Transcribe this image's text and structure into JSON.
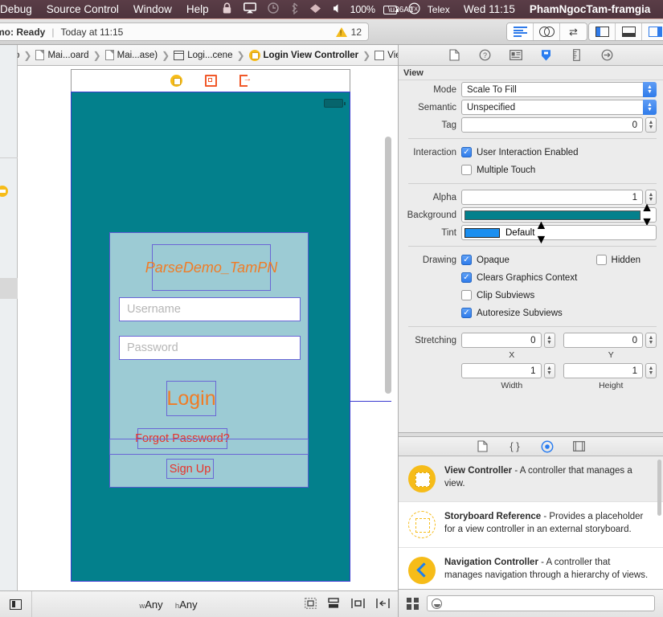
{
  "menubar": {
    "items": [
      "Debug",
      "Source Control",
      "Window",
      "Help"
    ],
    "icons": [
      "lock-icon",
      "airplay-icon",
      "time-machine-icon",
      "bluetooth-icon",
      "wifi-icon",
      "volume-icon"
    ],
    "battery_percent": "100%",
    "input_source": "Telex",
    "clock": "Wed 11:15",
    "user": "PhamNgocTam-framgia",
    "right_icons": [
      "search-icon",
      "control-center-icon"
    ]
  },
  "toolbar": {
    "status_scheme": "mo: Ready",
    "status_separator": "|",
    "status_time": "Today at 11:15",
    "warning_count": "12",
    "editor_buttons": [
      "standard-editor",
      "assistant-editor",
      "version-editor"
    ],
    "panel_buttons": [
      "navigator-toggle",
      "debug-toggle",
      "utilities-toggle"
    ]
  },
  "jumpbar": {
    "crumbs": [
      {
        "label": "emo",
        "icon": "project-icon"
      },
      {
        "label": "Mai...oard",
        "icon": "document-icon"
      },
      {
        "label": "Mai...ase)",
        "icon": "document-icon"
      },
      {
        "label": "Logi...cene",
        "icon": "storyboard-scene-icon"
      },
      {
        "label": "Login View Controller",
        "icon": "view-controller-icon"
      },
      {
        "label": "View",
        "icon": "view-icon"
      }
    ],
    "prev_label": "‹",
    "next_label": "›",
    "issue_icon": "warning-triangle-icon"
  },
  "scene": {
    "dock_items": [
      "view-controller-icon",
      "first-responder-icon",
      "exit-icon"
    ],
    "device_background": "#03808C",
    "panel_background": "#9CCBD4",
    "title": "ParseDemo_TamPN",
    "title_color": "#F07C26",
    "username_placeholder": "Username",
    "password_placeholder": "Password",
    "login_label": "Login",
    "login_color": "#F07C26",
    "forgot_label": "Forgot Password?",
    "signup_label": "Sign Up",
    "link_color": "#E8322A"
  },
  "bottombar": {
    "panel_icon": "view-as-icon",
    "width_prefix": "w",
    "width_value": "Any",
    "height_prefix": "h",
    "height_value": "Any",
    "autolayout_buttons": [
      "update-frames-icon",
      "embed-in-icon",
      "align-icon",
      "pin-icon"
    ]
  },
  "inspector": {
    "tabs": [
      "file-inspector",
      "quick-help-inspector",
      "identity-inspector",
      "attributes-inspector",
      "size-inspector",
      "connections-inspector"
    ],
    "selected_tab": "attributes-inspector",
    "section_title": "View",
    "mode_label": "Mode",
    "mode_value": "Scale To Fill",
    "semantic_label": "Semantic",
    "semantic_value": "Unspecified",
    "tag_label": "Tag",
    "tag_value": "0",
    "interaction_label": "Interaction",
    "user_interaction_label": "User Interaction Enabled",
    "user_interaction_checked": true,
    "multiple_touch_label": "Multiple Touch",
    "multiple_touch_checked": false,
    "alpha_label": "Alpha",
    "alpha_value": "1",
    "background_label": "Background",
    "background_color": "#03808C",
    "tint_label": "Tint",
    "tint_value": "Default",
    "tint_color": "#1b8ff0",
    "drawing_label": "Drawing",
    "opaque_label": "Opaque",
    "opaque_checked": true,
    "hidden_label": "Hidden",
    "hidden_checked": false,
    "clears_label": "Clears Graphics Context",
    "clears_checked": true,
    "clip_label": "Clip Subviews",
    "clip_checked": false,
    "autoresize_label": "Autoresize Subviews",
    "autoresize_checked": true,
    "stretching_label": "Stretching",
    "stretch_x": "0",
    "stretch_y": "0",
    "stretch_w": "1",
    "stretch_h": "1",
    "cap_x": "X",
    "cap_y": "Y",
    "cap_w": "Width",
    "cap_h": "Height"
  },
  "library": {
    "tabs": [
      "file-template-library",
      "code-snippet-library",
      "object-library",
      "media-library"
    ],
    "selected_tab": "object-library",
    "items": [
      {
        "icon": "view-controller-icon",
        "name": "View Controller",
        "desc": " - A controller that manages a view.",
        "selected": true
      },
      {
        "icon": "storyboard-reference-icon",
        "name": "Storyboard Reference",
        "desc": " - Provides a placeholder for a view controller in an external storyboard.",
        "selected": false
      },
      {
        "icon": "navigation-controller-icon",
        "name": "Navigation Controller",
        "desc": " - A controller that manages navigation through a hierarchy of views.",
        "selected": false
      }
    ],
    "filter_placeholder": "",
    "grid_toggle": "grid-view-icon",
    "search_icon": "filter-search-icon"
  }
}
